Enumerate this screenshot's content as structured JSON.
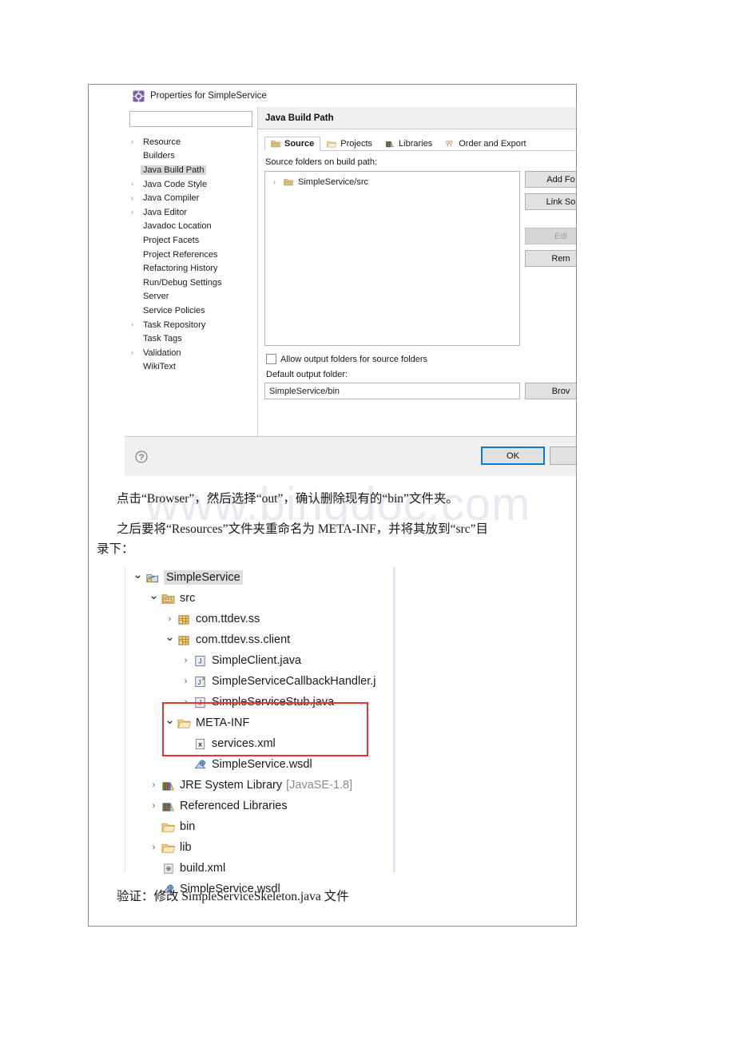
{
  "watermark": "www.bingdoc.com",
  "dialog": {
    "title": "Properties for SimpleService",
    "icon": "eclipse-properties-icon",
    "minimize_label": "–",
    "filter_placeholder": "",
    "filter_value": "",
    "nav_items": [
      {
        "label": "Resource",
        "arrow": true,
        "selected": false
      },
      {
        "label": "Builders",
        "arrow": false,
        "selected": false
      },
      {
        "label": "Java Build Path",
        "arrow": false,
        "selected": true
      },
      {
        "label": "Java Code Style",
        "arrow": true,
        "selected": false
      },
      {
        "label": "Java Compiler",
        "arrow": true,
        "selected": false
      },
      {
        "label": "Java Editor",
        "arrow": true,
        "selected": false
      },
      {
        "label": "Javadoc Location",
        "arrow": false,
        "selected": false
      },
      {
        "label": "Project Facets",
        "arrow": false,
        "selected": false
      },
      {
        "label": "Project References",
        "arrow": false,
        "selected": false
      },
      {
        "label": "Refactoring History",
        "arrow": false,
        "selected": false
      },
      {
        "label": "Run/Debug Settings",
        "arrow": false,
        "selected": false
      },
      {
        "label": "Server",
        "arrow": false,
        "selected": false
      },
      {
        "label": "Service Policies",
        "arrow": false,
        "selected": false
      },
      {
        "label": "Task Repository",
        "arrow": true,
        "selected": false
      },
      {
        "label": "Task Tags",
        "arrow": false,
        "selected": false
      },
      {
        "label": "Validation",
        "arrow": true,
        "selected": false
      },
      {
        "label": "WikiText",
        "arrow": false,
        "selected": false
      }
    ],
    "page_title": "Java Build Path",
    "back_arrow_icon": "back-arrow-icon",
    "tabs": [
      {
        "label": "Source",
        "icon": "source-folder-icon",
        "active": true
      },
      {
        "label": "Projects",
        "icon": "projects-icon",
        "active": false
      },
      {
        "label": "Libraries",
        "icon": "libraries-icon",
        "active": false
      },
      {
        "label": "Order and Export",
        "icon": "order-export-icon",
        "active": false
      }
    ],
    "source_caption": "Source folders on build path:",
    "source_entries": [
      {
        "label": "SimpleService/src",
        "arrow": true
      }
    ],
    "side_buttons": [
      {
        "label": "Add Fo",
        "disabled": false,
        "spacer": false
      },
      {
        "label": "Link So",
        "disabled": false,
        "spacer": false
      },
      {
        "label": "Edi",
        "disabled": true,
        "spacer": true
      },
      {
        "label": "Rem",
        "disabled": false,
        "spacer": false
      }
    ],
    "allow_output_label": "Allow output folders for source folders",
    "allow_output_checked": false,
    "default_output_label": "Default output folder:",
    "default_output_value": "SimpleService/bin",
    "browse_label": "Brov",
    "help_icon": "help-question-icon",
    "ok_label": "OK",
    "cancel_label": ""
  },
  "body_text": {
    "para1": "点击“Browser”，然后选择“out”，确认删除现有的“bin”文件夹。",
    "para2": "之后要将“Resources”文件夹重命名为 META-INF，并将其放到“src”目",
    "para2b": "录下：",
    "para3": "验证：修改 SimpleServiceSkeleton.java 文件"
  },
  "project_tree": {
    "highlight_color": "#e8352a",
    "nodes": [
      {
        "label": "SimpleService",
        "suffix": "",
        "indent": 0,
        "arrow": "down",
        "icon": "java-project-icon",
        "selected": true
      },
      {
        "label": "src",
        "suffix": "",
        "indent": 1,
        "arrow": "down",
        "icon": "source-folder-icon",
        "selected": false
      },
      {
        "label": "com.ttdev.ss",
        "suffix": "",
        "indent": 2,
        "arrow": "right",
        "icon": "package-icon",
        "selected": false
      },
      {
        "label": "com.ttdev.ss.client",
        "suffix": "",
        "indent": 2,
        "arrow": "down",
        "icon": "package-icon",
        "selected": false
      },
      {
        "label": "SimpleClient.java",
        "suffix": "",
        "indent": 3,
        "arrow": "right",
        "icon": "java-file-icon",
        "selected": false
      },
      {
        "label": "SimpleServiceCallbackHandler.j",
        "suffix": "",
        "indent": 3,
        "arrow": "right",
        "icon": "java-file-abstract-icon",
        "selected": false
      },
      {
        "label": "SimpleServiceStub.java",
        "suffix": "",
        "indent": 3,
        "arrow": "right",
        "icon": "java-file-icon",
        "selected": false
      },
      {
        "label": "META-INF",
        "suffix": "",
        "indent": 2,
        "arrow": "down",
        "icon": "folder-icon",
        "selected": false
      },
      {
        "label": "services.xml",
        "suffix": "",
        "indent": 3,
        "arrow": "none",
        "icon": "xml-file-icon",
        "selected": false
      },
      {
        "label": "SimpleService.wsdl",
        "suffix": "",
        "indent": 3,
        "arrow": "none",
        "icon": "wsdl-file-icon",
        "selected": false
      },
      {
        "label": "JRE System Library",
        "suffix": "[JavaSE-1.8]",
        "indent": 1,
        "arrow": "right",
        "icon": "library-icon",
        "selected": false
      },
      {
        "label": "Referenced Libraries",
        "suffix": "",
        "indent": 1,
        "arrow": "right",
        "icon": "library-icon",
        "selected": false
      },
      {
        "label": "bin",
        "suffix": "",
        "indent": 1,
        "arrow": "none",
        "icon": "folder-icon",
        "selected": false
      },
      {
        "label": "lib",
        "suffix": "",
        "indent": 1,
        "arrow": "right",
        "icon": "folder-icon",
        "selected": false
      },
      {
        "label": "build.xml",
        "suffix": "",
        "indent": 1,
        "arrow": "none",
        "icon": "ant-build-icon",
        "selected": false
      },
      {
        "label": "SimpleService.wsdl",
        "suffix": "",
        "indent": 1,
        "arrow": "none",
        "icon": "wsdl-file-icon",
        "selected": false
      }
    ]
  }
}
